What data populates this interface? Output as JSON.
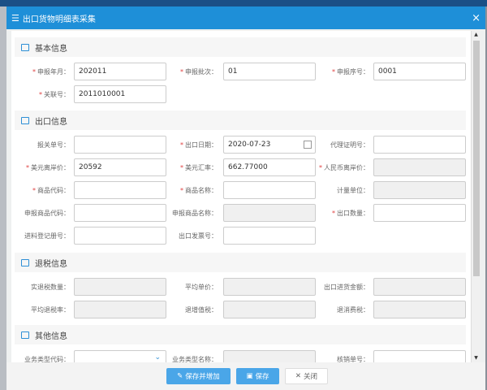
{
  "window": {
    "title": "出口货物明细表采集",
    "close": "×",
    "menu_icon": "menu-icon"
  },
  "sections": [
    {
      "title": "基本信息"
    },
    {
      "title": "出口信息"
    },
    {
      "title": "退税信息"
    },
    {
      "title": "其他信息"
    }
  ],
  "basic": {
    "declare_month": {
      "label": "申报年月：",
      "value": "202011"
    },
    "declare_batch": {
      "label": "申报批次：",
      "value": "01"
    },
    "declare_seq": {
      "label": "申报序号：",
      "value": "0001"
    },
    "link_no": {
      "label": "关联号：",
      "value": "2011010001"
    }
  },
  "export": {
    "customs_no": {
      "label": "报关单号：",
      "value": ""
    },
    "export_date": {
      "label": "出口日期：",
      "value": "2020-07-23"
    },
    "agency_cert": {
      "label": "代理证明号：",
      "value": ""
    },
    "usd_fob": {
      "label": "美元离岸价：",
      "value": "20592"
    },
    "usd_rate": {
      "label": "美元汇率：",
      "value": "662.77000"
    },
    "rmb_fob": {
      "label": "人民币离岸价：",
      "value": ""
    },
    "goods_code": {
      "label": "商品代码：",
      "value": ""
    },
    "goods_name": {
      "label": "商品名称：",
      "value": ""
    },
    "unit": {
      "label": "计量单位：",
      "value": ""
    },
    "decl_goods_code": {
      "label": "申报商品代码：",
      "value": ""
    },
    "decl_goods_name": {
      "label": "申报商品名称：",
      "value": ""
    },
    "export_qty": {
      "label": "出口数量：",
      "value": ""
    },
    "material_reg": {
      "label": "进料登记册号：",
      "value": ""
    },
    "invoice_no": {
      "label": "出口发票号：",
      "value": ""
    }
  },
  "refund": {
    "refund_qty": {
      "label": "实退税数量：",
      "value": ""
    },
    "avg_price": {
      "label": "平均单价：",
      "value": ""
    },
    "purchase_amount": {
      "label": "出口进货金额：",
      "value": ""
    },
    "avg_rate": {
      "label": "平均退税率：",
      "value": ""
    },
    "vat_refund": {
      "label": "退增值税：",
      "value": ""
    },
    "consumption_refund": {
      "label": "退消费税：",
      "value": ""
    }
  },
  "other": {
    "biz_type_code": {
      "label": "业务类型代码：",
      "value": ""
    },
    "biz_type_name": {
      "label": "业务类型名称：",
      "value": ""
    },
    "verification_no": {
      "label": "核销单号：",
      "value": ""
    }
  },
  "footer": {
    "save_add": "保存并增加",
    "save": "保存",
    "close": "关闭"
  },
  "colors": {
    "primary": "#1e8fd8",
    "button": "#4aa6e8",
    "required": "#e04040"
  }
}
